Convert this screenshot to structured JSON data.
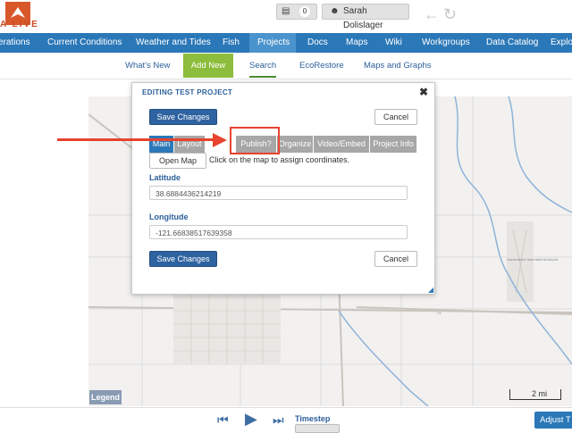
{
  "app": {
    "logo_text": "A LIVE",
    "basket_count": "0",
    "user_name": "Sarah Dolislager"
  },
  "main_nav": [
    "erations",
    "Current Conditions",
    "Weather and Tides",
    "Fish",
    "Projects",
    "Docs",
    "Maps",
    "Wiki",
    "Workgroups",
    "Data Catalog",
    "Explor"
  ],
  "sub_nav": [
    "What's New",
    "Add New",
    "Search",
    "EcoRestore",
    "Maps and Graphs"
  ],
  "dialog": {
    "title": "EDITING TEST PROJECT",
    "save_label": "Save Changes",
    "cancel_label": "Cancel",
    "tabs": [
      "Main",
      "Layout",
      "Publish?",
      "Organize",
      "Video/Embed",
      "Project Info"
    ],
    "open_map_label": "Open Map",
    "map_hint": "Click on the map to assign coordinates.",
    "latitude_label": "Latitude",
    "latitude_value": "38.6884436214219",
    "longitude_label": "Longitude",
    "longitude_value": "-121.66838517639358"
  },
  "map": {
    "legend_label": "Legend",
    "scale_label": "2 mi"
  },
  "bottom": {
    "timestep_label": "Timestep",
    "adjust_label": "Adjust T"
  },
  "colors": {
    "nav_blue": "#2b78b8",
    "active_green": "#8dbd3c",
    "annotation_red": "#e8432f"
  }
}
